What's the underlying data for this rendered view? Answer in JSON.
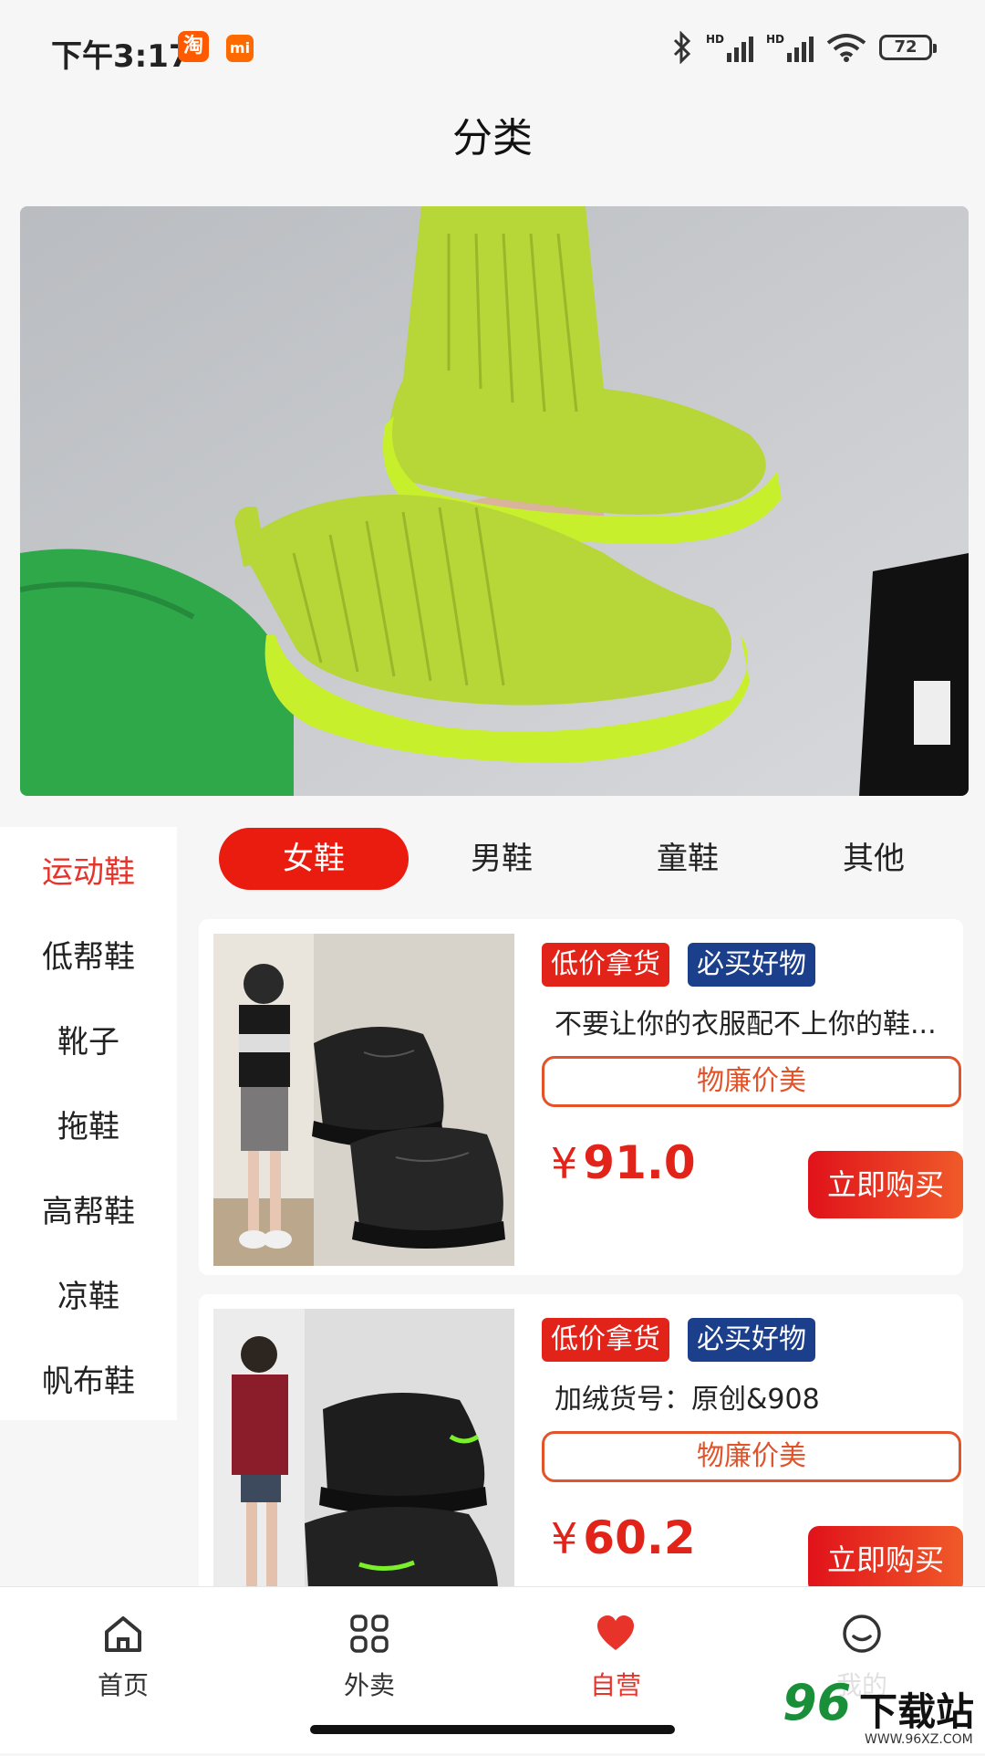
{
  "status_bar": {
    "time": "下午3:17",
    "taobao_badge": "淘",
    "mi_badge": "mi",
    "battery": "72",
    "signal_label_1": "HD",
    "signal_label_2": "HD"
  },
  "header": {
    "title": "分类"
  },
  "categories": [
    {
      "label": "运动鞋",
      "active": true
    },
    {
      "label": "低帮鞋"
    },
    {
      "label": "靴子"
    },
    {
      "label": "拖鞋"
    },
    {
      "label": "高帮鞋"
    },
    {
      "label": "凉鞋"
    },
    {
      "label": "帆布鞋"
    }
  ],
  "tabs": [
    {
      "label": "女鞋",
      "active": true
    },
    {
      "label": "男鞋"
    },
    {
      "label": "童鞋"
    },
    {
      "label": "其他"
    }
  ],
  "products": [
    {
      "badge_red": "低价拿货",
      "badge_blue": "必买好物",
      "name": "不要让你的衣服配不上你的鞋...",
      "slogan": "物廉价美",
      "currency": "¥",
      "price": "91.0",
      "buy_label": "立即购买"
    },
    {
      "badge_red": "低价拿货",
      "badge_blue": "必买好物",
      "name": "加绒货号：原创&908",
      "slogan": "物廉价美",
      "currency": "¥",
      "price": "60.2",
      "buy_label": "立即购买"
    }
  ],
  "bottom_nav": [
    {
      "label": "首页",
      "icon": "home-icon"
    },
    {
      "label": "外卖",
      "icon": "grid-icon"
    },
    {
      "label": "自营",
      "icon": "heart-icon",
      "active": true
    },
    {
      "label": "我的",
      "icon": "smile-icon"
    }
  ],
  "watermark": {
    "brand_number": "96",
    "brand_text": "下载站",
    "url": "WWW.96XZ.COM"
  },
  "colors": {
    "accent": "#e8332a",
    "badge_blue": "#1c3f8c",
    "buy_gradient_start": "#e0121a"
  }
}
